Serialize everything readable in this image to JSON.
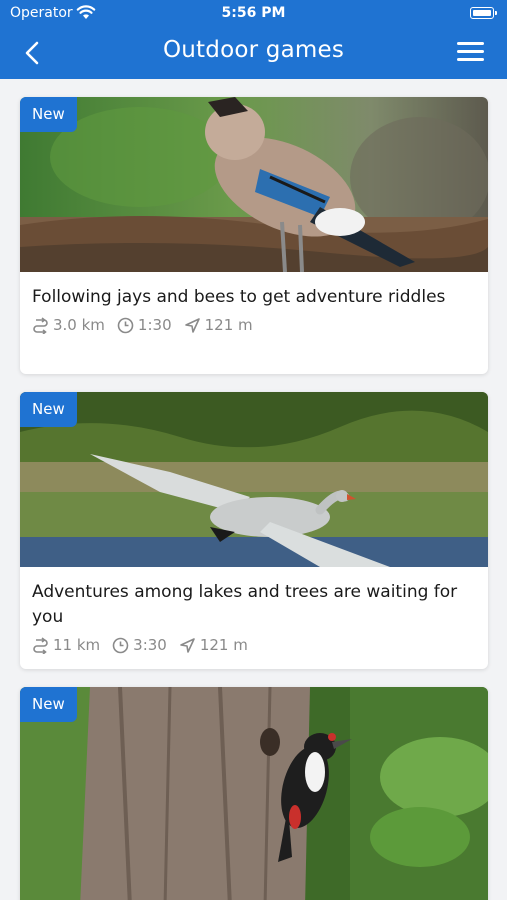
{
  "status_bar": {
    "carrier": "Operator",
    "time": "5:56 PM"
  },
  "nav": {
    "title": "Outdoor games",
    "back_icon": "chevron-left-icon",
    "menu_icon": "hamburger-menu-icon"
  },
  "colors": {
    "brand": "#1f73d2",
    "meta_text": "#8a8a8a"
  },
  "games": [
    {
      "badge": "New",
      "image": "jay-bird-photo",
      "title": "Following jays and bees to get adventure riddles",
      "distance": "3.0 km",
      "duration": "1:30",
      "proximity": "121 m"
    },
    {
      "badge": "New",
      "image": "flying-swan-photo",
      "title": "Adventures among lakes and trees are waiting for you",
      "distance": "11 km",
      "duration": "3:30",
      "proximity": "121 m"
    },
    {
      "badge": "New",
      "image": "woodpecker-photo"
    }
  ]
}
